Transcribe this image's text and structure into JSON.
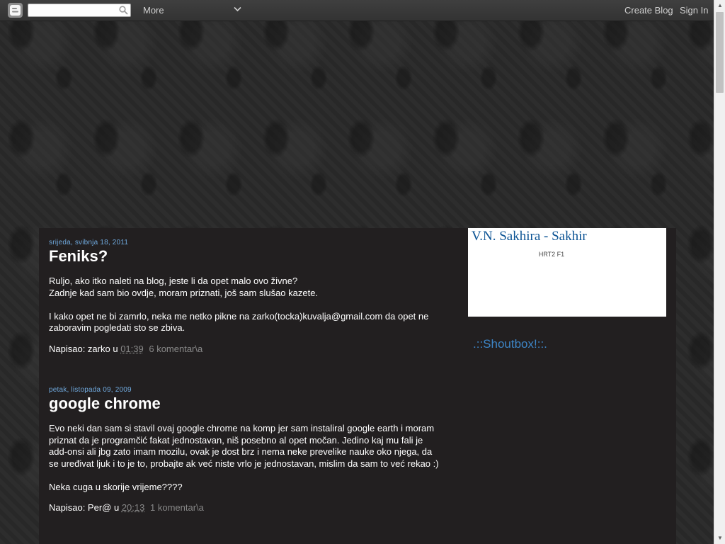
{
  "navbar": {
    "search_placeholder": "",
    "more_label": "More",
    "create_blog": "Create Blog",
    "sign_in": "Sign In"
  },
  "posts": [
    {
      "date": "srijeda, svibnja 18, 2011",
      "title": "Feniks?",
      "paragraphs": [
        "Ruljo, ako itko naleti na blog, jeste li da opet malo ovo živne?",
        "Zadnje kad sam bio ovdje, moram priznati, još sam slušao kazete.",
        "",
        "I kako opet ne bi zamrlo, neka me netko pikne na zarko(tocka)kuvalja@gmail.com da opet ne zaboravim pogledati sto se zbiva."
      ],
      "footer_prefix": "Napisao: zarko u",
      "time": "01:39",
      "comments": "6 komentar\\a"
    },
    {
      "date": "petak, listopada 09, 2009",
      "title": "google chrome",
      "paragraphs": [
        "Evo neki dan sam si stavil ovaj google chrome na komp jer sam instaliral google earth i moram priznat da je programčić fakat jednostavan, niš posebno al opet močan. Jedino kaj mu fali je add-onsi ali jbg zato imam mozilu, ovak je dost brz i nema neke prevelike nauke oko njega, da se uređivat ljuk i to je to, probajte ak već niste vrlo je jednostavan, mislim da sam to već rekao :)",
        "",
        "Neka cuga u skorije vrijeme????"
      ],
      "footer_prefix": "Napisao: Per@ u",
      "time": "20:13",
      "comments": "1 komentar\\a"
    }
  ],
  "sidebar": {
    "widget_title": "V.N. Sakhira - Sakhir",
    "widget_sub": "HRT2 F1",
    "shoutbox_title": ".::Shoutbox!::."
  },
  "icons": {
    "logo": "blogger-icon",
    "search": "search-icon",
    "more": "chevron-down-icon"
  },
  "colors": {
    "link_blue": "#6fa8dc",
    "title_blue": "#0b5394",
    "content_bg": "#221f20"
  }
}
